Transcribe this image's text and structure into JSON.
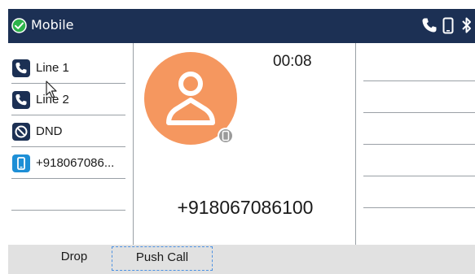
{
  "header": {
    "title": "Mobile",
    "status_color": "#2db34a",
    "icons": [
      "check-circle-icon",
      "phone-icon",
      "mobile-device-icon",
      "bluetooth-icon"
    ]
  },
  "lines": [
    {
      "label": "Line 1",
      "icon": "phone-icon"
    },
    {
      "label": "Line 2",
      "icon": "phone-icon"
    },
    {
      "label": "DND",
      "icon": "do-not-disturb-icon"
    },
    {
      "label": "+918067086...",
      "icon": "mobile-device-icon"
    }
  ],
  "call": {
    "timer": "00:08",
    "number": "+918067086100",
    "avatar_color": "#f5975f"
  },
  "softkeys": {
    "drop": "Drop",
    "push_call": "Push Call"
  }
}
